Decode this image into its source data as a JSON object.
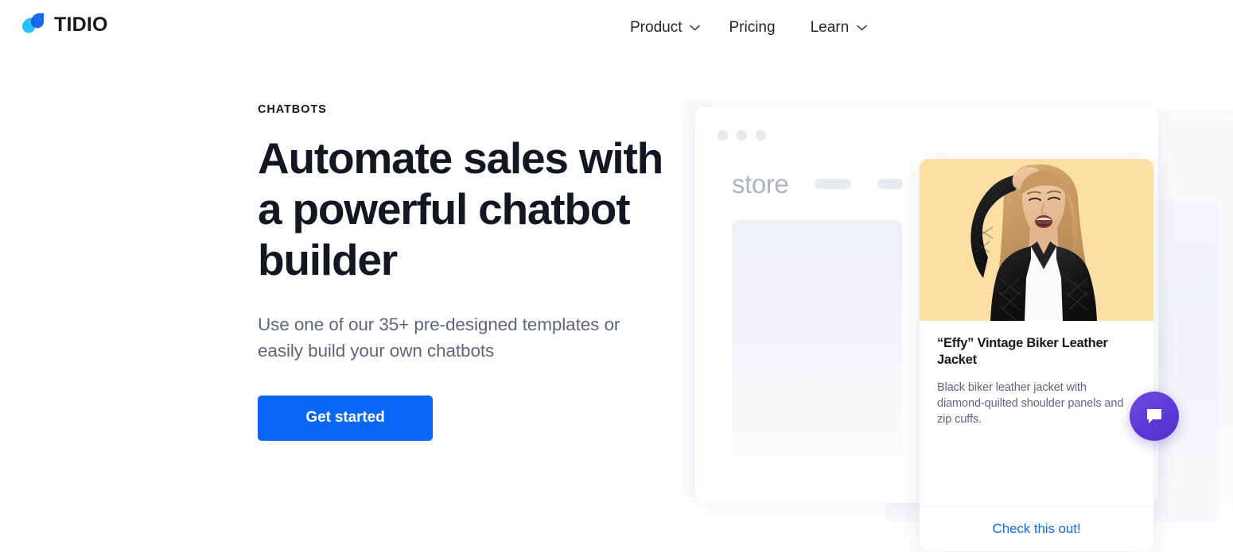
{
  "header": {
    "brand_name": "TIDIO",
    "nav": [
      {
        "label": "Product",
        "caret": true
      },
      {
        "label": "Pricing",
        "caret": false
      },
      {
        "label": "Learn",
        "caret": true
      }
    ]
  },
  "hero": {
    "eyebrow": "CHATBOTS",
    "headline": "Automate sales with a powerful chatbot builder",
    "subhead": "Use one of our 35+ pre-designed templates or easily build your own chatbots",
    "cta_label": "Get started"
  },
  "illustration": {
    "browser": {
      "store_label": "store"
    },
    "product_card": {
      "title": "“Effy” Vintage Biker Leather Jacket",
      "description": "Black biker leather jacket with diamond-quilted shoulder panels and zip cuffs.",
      "action_label": "Check this out!",
      "photo_bg": "#fbdfa4"
    },
    "chat_launcher": {
      "color": "#5c39d6"
    }
  },
  "colors": {
    "brand_dark_blue": "#1a6bf0",
    "brand_light_blue": "#29c1ff",
    "cta_blue": "#0a66f7",
    "link_blue": "#1369e0",
    "heading": "#131722",
    "body_text": "#5d6779"
  }
}
